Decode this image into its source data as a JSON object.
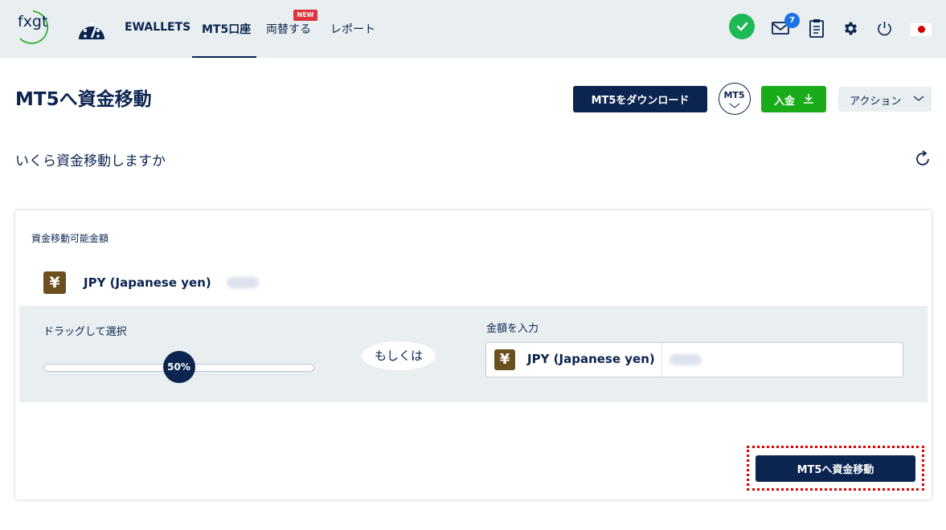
{
  "brand": {
    "logo_text": "fxgt"
  },
  "nav": {
    "items": [
      {
        "label": "EWALLETS"
      },
      {
        "label": "MT5口座",
        "active": true
      },
      {
        "label": "両替する",
        "badge": "NEW"
      },
      {
        "label": "レポート"
      }
    ]
  },
  "header_icons": {
    "verified": "check-icon",
    "mail_count": "7",
    "icons": [
      "check-icon",
      "mail-icon",
      "clipboard-icon",
      "gear-icon",
      "power-icon",
      "japan-flag-icon"
    ]
  },
  "page": {
    "title": "MT5へ資金移動",
    "subtitle": "いくら資金移動しますか"
  },
  "actions": {
    "download_label": "MT5をダウンロード",
    "platform_label": "MT5",
    "deposit_label": "入金",
    "action_label": "アクション"
  },
  "transfer": {
    "available_label": "資金移動可能金額",
    "currency_symbol": "¥",
    "currency_name": "JPY (Japanese yen)",
    "drag_label": "ドラッグして選択",
    "slider_value": "50%",
    "slider_fraction": 0.5,
    "or_label": "もしくは",
    "amount_label": "金額を入力",
    "submit_label": "MT5へ資金移動"
  },
  "colors": {
    "navy": "#0b2450",
    "green": "#1aab1a",
    "yen_badge": "#6b4f1e",
    "highlight": "#e00000"
  }
}
